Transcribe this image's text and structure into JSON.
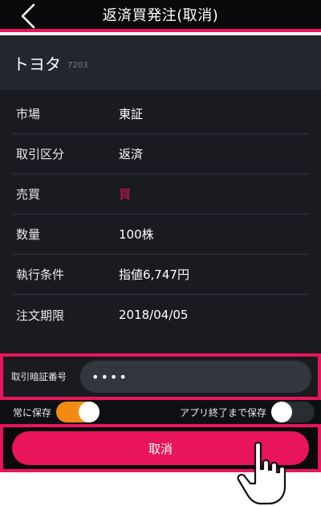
{
  "header": {
    "title": "返済買発注(取消)"
  },
  "stock": {
    "name": "トヨタ",
    "code": "7203"
  },
  "details": [
    {
      "label": "市場",
      "value": "東証"
    },
    {
      "label": "取引区分",
      "value": "返済"
    },
    {
      "label": "売買",
      "value": "買"
    },
    {
      "label": "数量",
      "value": "100株"
    },
    {
      "label": "執行条件",
      "value": "指値6,747円"
    },
    {
      "label": "注文期限",
      "value": "2018/04/05"
    }
  ],
  "pin": {
    "label": "取引暗証番号",
    "value": "••••"
  },
  "save": {
    "always_save_label": "常に保存",
    "always_save_on": true,
    "save_until_exit_label": "アプリ終了まで保存",
    "save_until_exit_on": false
  },
  "action": {
    "cancel_label": "取消"
  },
  "colors": {
    "accent": "#e8155a",
    "toggle_on": "#f28b13",
    "buy": "#e8155a"
  },
  "icons": {
    "back": "chevron-left-icon",
    "pointer": "hand-pointer-icon"
  }
}
